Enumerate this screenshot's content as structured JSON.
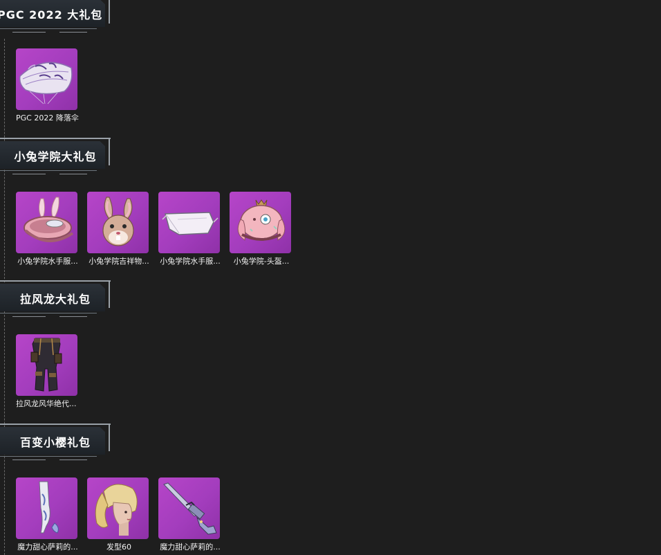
{
  "sections": [
    {
      "title": "PGC 2022 大礼包",
      "items": [
        {
          "label": "PGC 2022 降落伞",
          "icon": "parachute-icon"
        }
      ]
    },
    {
      "title": "小兔学院大礼包",
      "items": [
        {
          "label": "小兔学院水手服...",
          "icon": "bunny-ears-hat-icon"
        },
        {
          "label": "小兔学院吉祥物...",
          "icon": "bunny-mascot-head-icon"
        },
        {
          "label": "小兔学院水手服...",
          "icon": "sailor-mask-icon"
        },
        {
          "label": "小兔学院-头盔...",
          "icon": "bunny-helmet-icon"
        }
      ]
    },
    {
      "title": "拉风龙大礼包",
      "items": [
        {
          "label": "拉风龙风华绝代...",
          "icon": "cargo-pants-icon"
        }
      ]
    },
    {
      "title": "百变小樱礼包",
      "items": [
        {
          "label": "魔力甜心萨莉的...",
          "icon": "stockings-icon"
        },
        {
          "label": "发型60",
          "icon": "blonde-hair-head-icon"
        },
        {
          "label": "魔力甜心萨莉的...",
          "icon": "rifle-icon"
        }
      ]
    }
  ]
}
